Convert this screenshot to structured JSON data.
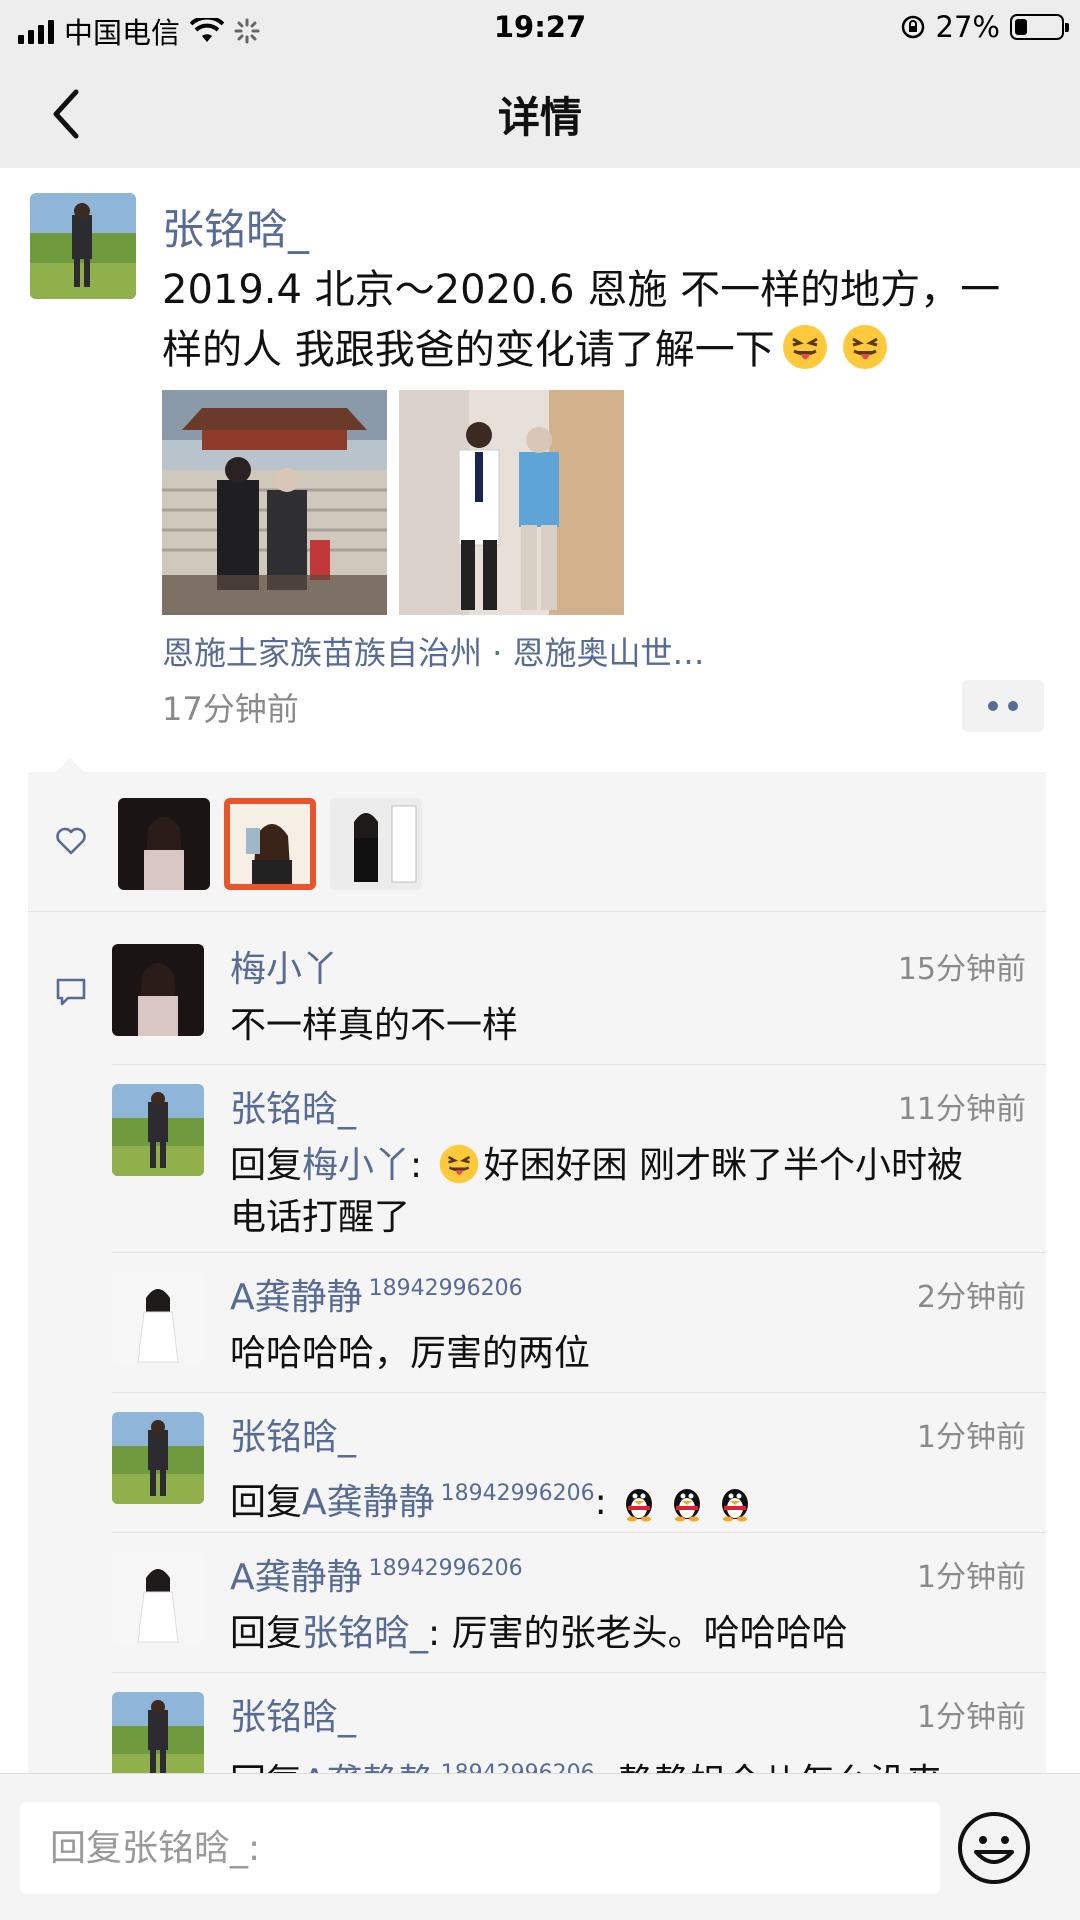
{
  "status": {
    "carrier": "中国电信",
    "time": "19:27",
    "battery": "27%"
  },
  "nav": {
    "title": "详情"
  },
  "post": {
    "author": "张铭晗_",
    "text_line1": "2019.4 北京～2020.6 恩施 不一样的地方，一",
    "text_line2": "样的人 我跟我爸的变化请了解一下",
    "location": "恩施土家族苗族自治州 · 恩施奥山世…",
    "time": "17分钟前"
  },
  "comments": [
    {
      "name": "梅小丫",
      "suffix": "",
      "time": "15分钟前",
      "text": "不一样真的不一样"
    },
    {
      "name": "张铭晗_",
      "suffix": "",
      "time": "11分钟前",
      "reply_prefix": "回复",
      "reply_to": "梅小丫",
      "text_line1": "好困好困 刚才眯了半个小时被",
      "text_line2": "电话打醒了"
    },
    {
      "name": "A龚静静",
      "suffix": "18942996206",
      "time": "2分钟前",
      "text": "哈哈哈哈，厉害的两位"
    },
    {
      "name": "张铭晗_",
      "suffix": "",
      "time": "1分钟前",
      "reply_prefix": "回复",
      "reply_to": "A龚静静",
      "reply_to_suffix": "18942996206",
      "text": ":"
    },
    {
      "name": "A龚静静",
      "suffix": "18942996206",
      "time": "1分钟前",
      "reply_prefix": "回复",
      "reply_to": "张铭晗_",
      "text": ": 厉害的张老头。哈哈哈哈"
    },
    {
      "name": "张铭晗_",
      "suffix": "",
      "time": "1分钟前",
      "reply_prefix": "回复",
      "reply_to": "A龚静静",
      "reply_to_suffix": "18942996206",
      "text": ": 静静姐今儿怎么没来"
    }
  ],
  "reply_bar": {
    "placeholder": "回复张铭晗_:"
  },
  "colors": {
    "link": "#576b95",
    "bar_bg": "#ededed",
    "comment_bg": "#f5f5f5"
  }
}
